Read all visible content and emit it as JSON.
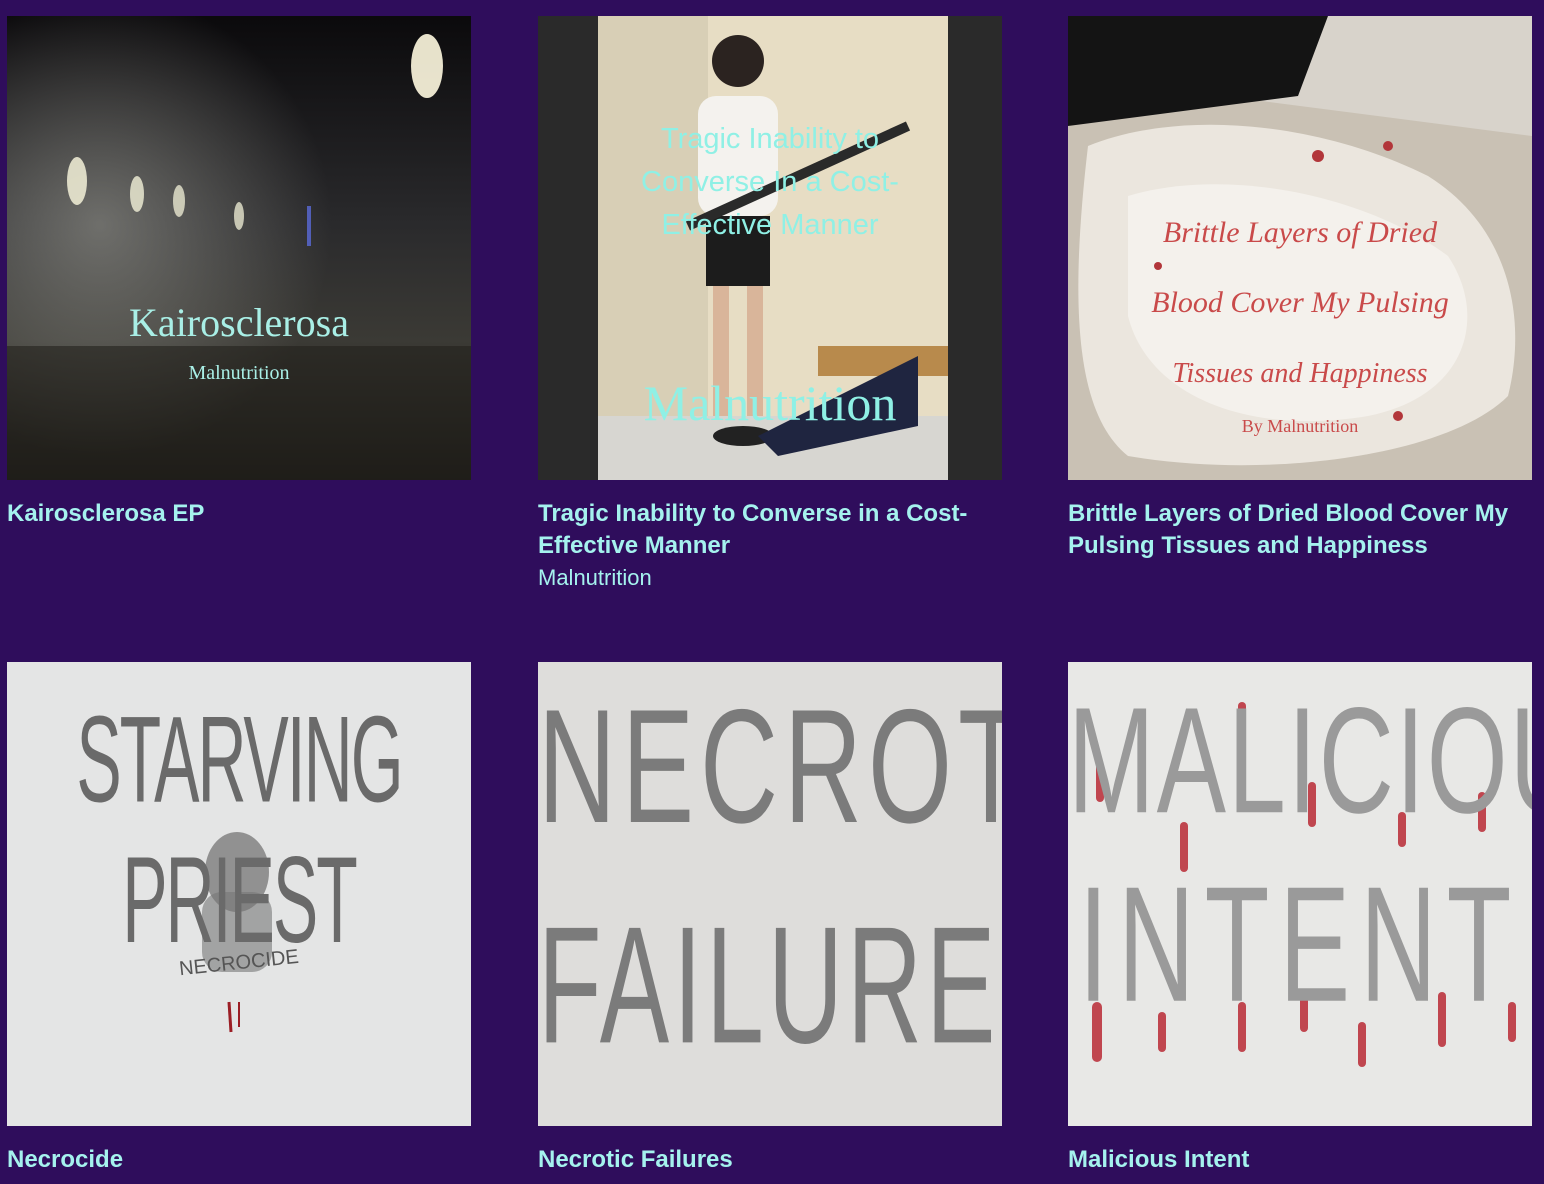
{
  "colors": {
    "background": "#2f0d5c",
    "text": "#a5f2ee"
  },
  "albums": [
    {
      "title": "Kairosclerosa EP",
      "artist": "",
      "cover_text": [
        "Kairosclerosa",
        "Malnutrition"
      ]
    },
    {
      "title": "Tragic Inability to Converse in a Cost-Effective Manner",
      "artist": "Malnutrition",
      "cover_text": [
        "Tragic Inability to Converse In a Cost-Effective Manner",
        "Malnutrition"
      ]
    },
    {
      "title": "Brittle Layers of Dried Blood Cover My Pulsing Tissues and Happiness",
      "artist": "",
      "cover_text": [
        "Brittle Layers of Dried",
        "Blood Cover My Pulsing",
        "Tissues and Happiness",
        "By Malnutrition"
      ]
    },
    {
      "title": "Necrocide",
      "artist": "",
      "cover_text": [
        "STARVING PRIEST",
        "NECROCIDE"
      ]
    },
    {
      "title": "Necrotic Failures",
      "artist": "",
      "cover_text": [
        "NECROTIC",
        "FAILURES"
      ]
    },
    {
      "title": "Malicious Intent",
      "artist": "",
      "cover_text": [
        "MALICIOUS",
        "INTENT"
      ]
    }
  ]
}
